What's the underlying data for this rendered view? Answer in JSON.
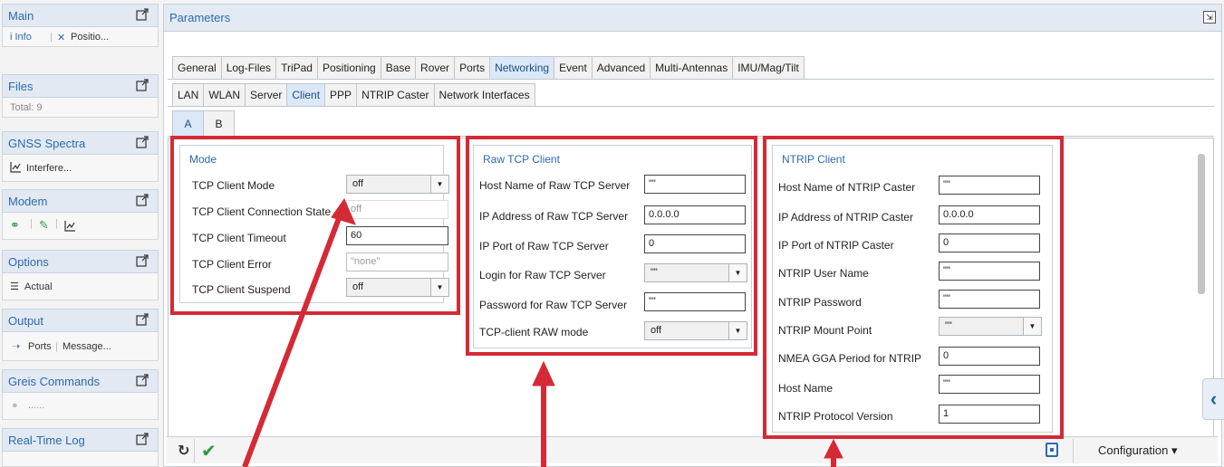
{
  "sidebar": {
    "main": {
      "title": "Main",
      "items": [
        "i Info",
        "Positio..."
      ]
    },
    "files": {
      "title": "Files",
      "total": "Total: 9"
    },
    "spectra": {
      "title": "GNSS Spectra",
      "item": "Interfere..."
    },
    "modem": {
      "title": "Modem"
    },
    "options": {
      "title": "Options",
      "item": "Actual"
    },
    "output": {
      "title": "Output",
      "items": [
        "Ports",
        "Message..."
      ]
    },
    "greis": {
      "title": "Greis Commands",
      "item": "......"
    },
    "rtlog": {
      "title": "Real-Time Log"
    }
  },
  "main": {
    "title": "Parameters",
    "tabs1": [
      "General",
      "Log-Files",
      "TriPad",
      "Positioning",
      "Base",
      "Rover",
      "Ports",
      "Networking",
      "Event",
      "Advanced",
      "Multi-Antennas",
      "IMU/Mag/Tilt"
    ],
    "tabs1_active": "Networking",
    "tabs2": [
      "LAN",
      "WLAN",
      "Server",
      "Client",
      "PPP",
      "NTRIP Caster",
      "Network Interfaces"
    ],
    "tabs2_active": "Client",
    "tabs3": [
      "A",
      "B"
    ],
    "tabs3_active": "A"
  },
  "mode": {
    "title": "Mode",
    "rows": [
      {
        "label": "TCP Client Mode",
        "value": "off"
      },
      {
        "label": "TCP Client Connection State",
        "value": "off"
      },
      {
        "label": "TCP Client Timeout",
        "value": "60"
      },
      {
        "label": "TCP Client Error",
        "value": "\"none\""
      },
      {
        "label": "TCP Client Suspend",
        "value": "off"
      }
    ]
  },
  "raw": {
    "title": "Raw TCP Client",
    "rows": [
      {
        "label": "Host Name of Raw TCP Server",
        "value": "\"\""
      },
      {
        "label": "IP Address of Raw TCP Server",
        "value": "0.0.0.0"
      },
      {
        "label": "IP Port of Raw TCP Server",
        "value": "0"
      },
      {
        "label": "Login for Raw TCP Server",
        "value": "\"\""
      },
      {
        "label": "Password for Raw TCP Server",
        "value": "\"\""
      },
      {
        "label": "TCP-client RAW mode",
        "value": "off"
      }
    ]
  },
  "ntrip": {
    "title": "NTRIP Client",
    "rows": [
      {
        "label": "Host Name of NTRIP Caster",
        "value": "\"\""
      },
      {
        "label": "IP Address of NTRIP Caster",
        "value": "0.0.0.0"
      },
      {
        "label": "IP Port of NTRIP Caster",
        "value": "0"
      },
      {
        "label": "NTRIP User Name",
        "value": "\"\""
      },
      {
        "label": "NTRIP Password",
        "value": "\"\""
      },
      {
        "label": "NTRIP Mount Point",
        "value": "\"\""
      },
      {
        "label": "NMEA GGA Period for NTRIP",
        "value": "0"
      },
      {
        "label": "Host Name",
        "value": "\"\""
      },
      {
        "label": "NTRIP Protocol Version",
        "value": "1"
      }
    ]
  },
  "bottom": {
    "configuration": "Configuration"
  },
  "colors": {
    "accent": "#2d6ab0",
    "highlight": "#d42a35"
  }
}
